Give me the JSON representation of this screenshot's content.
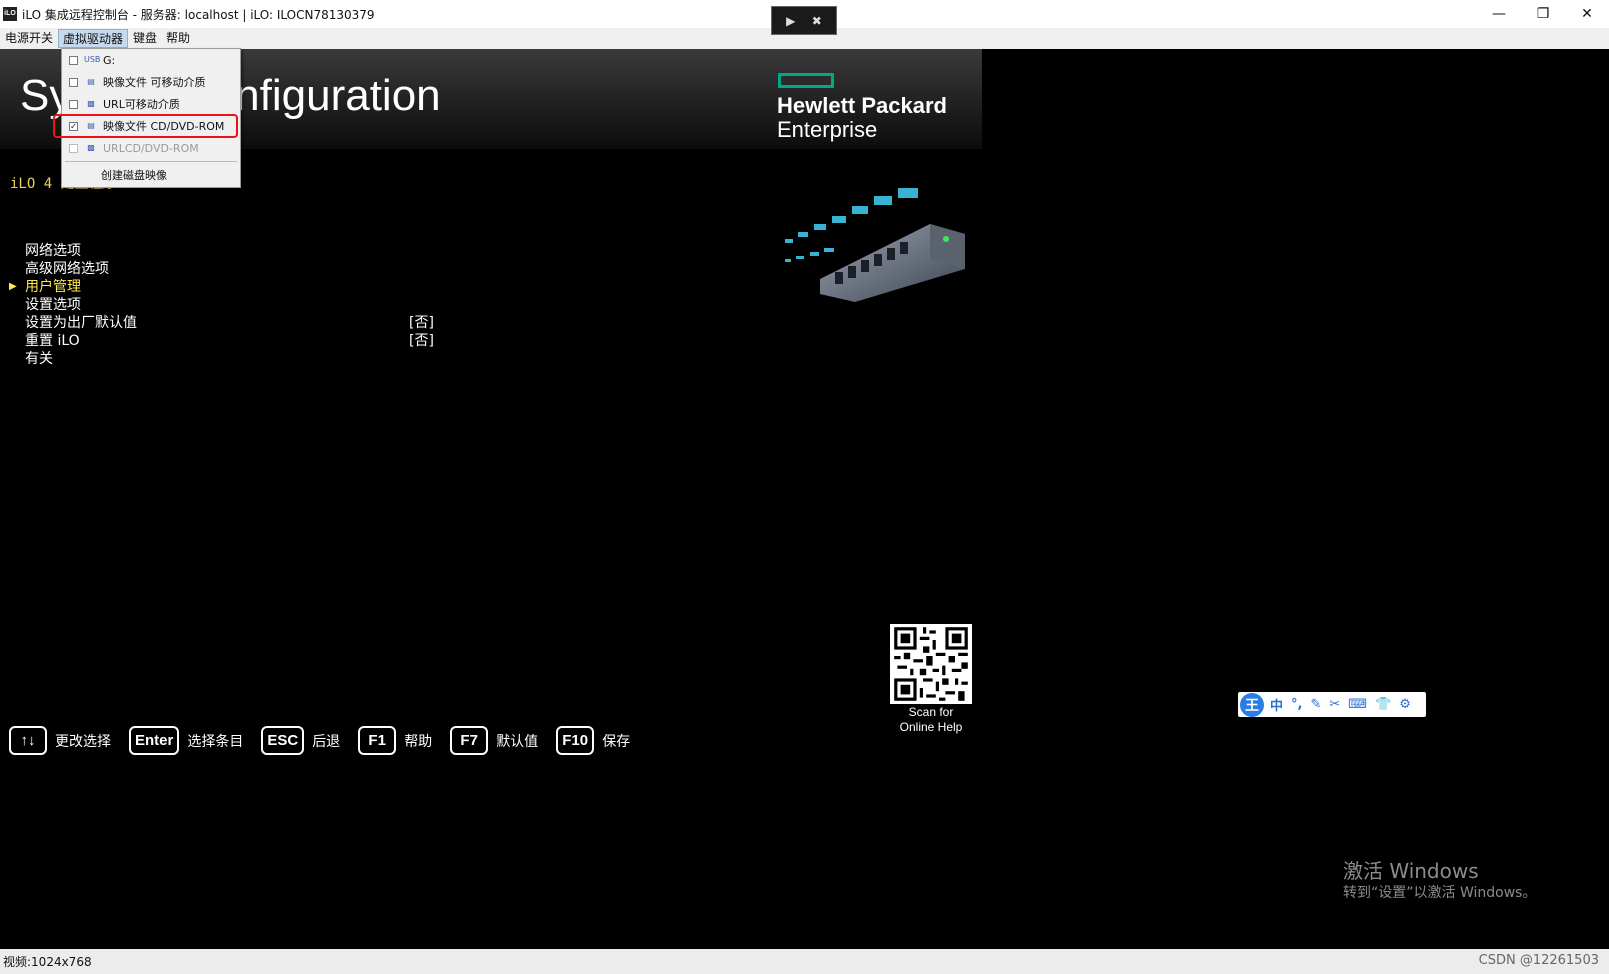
{
  "window": {
    "app_icon": "iLO",
    "title": "iLO 集成远程控制台 - 服务器: localhost | iLO: ILOCN78130379",
    "controls": [
      "minimize-icon",
      "restore-icon",
      "close-icon"
    ]
  },
  "remote_toolbar": {
    "icons": [
      "pin-icon",
      "close-circle-icon"
    ]
  },
  "menubar": {
    "items": [
      "电源开关",
      "虚拟驱动器",
      "键盘",
      "帮助"
    ]
  },
  "dropdown": {
    "items": [
      {
        "label": "G:",
        "checked": false,
        "icon": "usb-drive-icon",
        "enabled": true
      },
      {
        "label": "映像文件 可移动介质",
        "checked": false,
        "icon": "image-file-icon",
        "enabled": true
      },
      {
        "label": "URL可移动介质",
        "checked": false,
        "icon": "network-drive-icon",
        "enabled": true
      },
      {
        "label": "映像文件 CD/DVD-ROM",
        "checked": true,
        "icon": "image-file-icon",
        "enabled": true,
        "highlighted": true
      },
      {
        "label": "URLCD/DVD-ROM",
        "checked": false,
        "icon": "network-cd-icon",
        "enabled": false
      },
      {
        "label": "创建磁盘映像",
        "enabled": true
      }
    ]
  },
  "screen": {
    "title": "System Configuration",
    "brand_line1": "Hewlett Packard",
    "brand_line2": "Enterprise",
    "subtitle": "iLO 4 配置程序",
    "menu": [
      {
        "label": "网络选项",
        "value": "",
        "selected": false
      },
      {
        "label": "高级网络选项",
        "value": "",
        "selected": false
      },
      {
        "label": "用户管理",
        "value": "",
        "selected": true
      },
      {
        "label": "设置选项",
        "value": "",
        "selected": false
      },
      {
        "label": "设置为出厂默认值",
        "value": "[否]",
        "selected": false
      },
      {
        "label": "重置 iLO",
        "value": "[否]",
        "selected": false
      },
      {
        "label": "有关",
        "value": "",
        "selected": false
      }
    ],
    "qr_text_line1": "Scan for",
    "qr_text_line2": "Online Help",
    "keys": [
      {
        "key": "↑↓",
        "label": "更改选择"
      },
      {
        "key": "Enter",
        "label": "选择条目"
      },
      {
        "key": "ESC",
        "label": "后退"
      },
      {
        "key": "F1",
        "label": "帮助"
      },
      {
        "key": "F7",
        "label": "默认值"
      },
      {
        "key": "F10",
        "label": "保存"
      }
    ]
  },
  "ime_toolbar": {
    "logo": "王",
    "buttons": [
      "中",
      "°,",
      "✎",
      "✂",
      "⌨",
      "👕",
      "⚙"
    ]
  },
  "activation": {
    "line1": "激活 Windows",
    "line2": "转到“设置”以激活 Windows。"
  },
  "statusbar": {
    "video": "视频:1024x768",
    "watermark": "CSDN @12261503"
  },
  "colors": {
    "hpe_green": "#01a982",
    "selected_item": "#ffe94a",
    "highlight_box": "#e11111"
  }
}
